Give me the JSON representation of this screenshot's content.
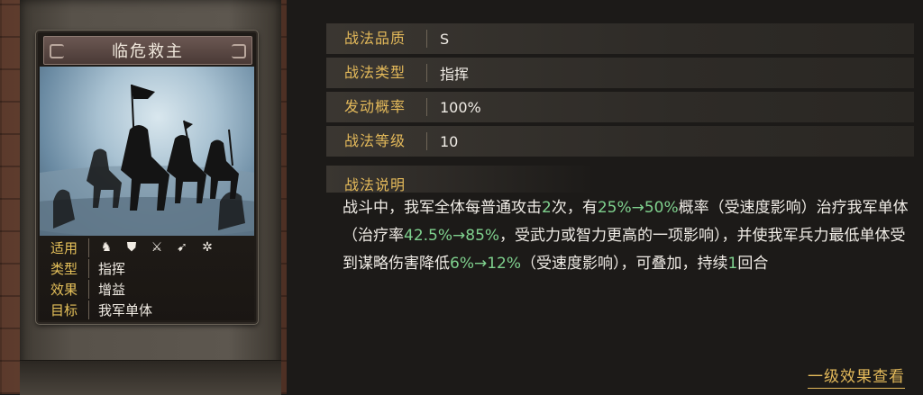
{
  "card": {
    "title": "临危救主",
    "meta": {
      "applicable_label": "适用",
      "applicable_icons": [
        "cavalry-icon",
        "shield-icon",
        "crossed-swords-icon",
        "spear-icon",
        "wheel-icon"
      ],
      "type_label": "类型",
      "type_value": "指挥",
      "effect_label": "效果",
      "effect_value": "增益",
      "target_label": "目标",
      "target_value": "我军单体"
    }
  },
  "stats": [
    {
      "key": "战法品质",
      "value": "S"
    },
    {
      "key": "战法类型",
      "value": "指挥"
    },
    {
      "key": "发动概率",
      "value": "100%"
    },
    {
      "key": "战法等级",
      "value": "10"
    }
  ],
  "description": {
    "title": "战法说明",
    "segments": [
      {
        "text": "战斗中，我军全体每普通攻击",
        "hl": false
      },
      {
        "text": "2",
        "hl": true
      },
      {
        "text": "次，有",
        "hl": false
      },
      {
        "text": "25%→50%",
        "hl": true
      },
      {
        "text": "概率（受速度影响）治疗我军单体（治疗率",
        "hl": false
      },
      {
        "text": "42.5%→85%",
        "hl": true
      },
      {
        "text": "，受武力或智力更高的一项影响），并使我军兵力最低单体受到谋略伤害降低",
        "hl": false
      },
      {
        "text": "6%→12%",
        "hl": true
      },
      {
        "text": "（受速度影响），可叠加，持续",
        "hl": false
      },
      {
        "text": "1",
        "hl": true
      },
      {
        "text": "回合",
        "hl": false
      }
    ]
  },
  "link": {
    "label": "一级效果查看"
  },
  "colors": {
    "label_gold": "#e3b95a",
    "highlight_green": "#7fd18e"
  }
}
